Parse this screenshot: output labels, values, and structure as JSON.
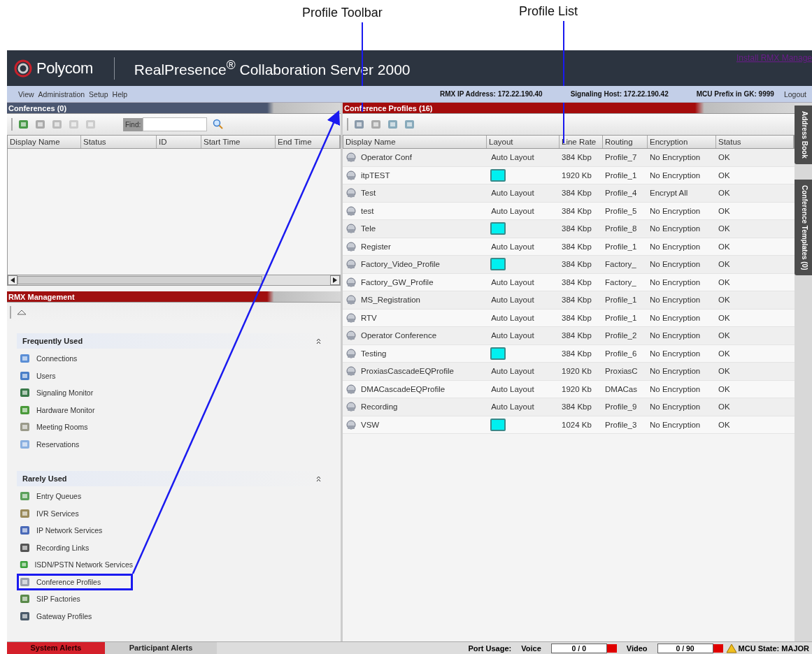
{
  "annotations": [
    {
      "label": "Profile Toolbar"
    },
    {
      "label": "Profile List"
    }
  ],
  "header": {
    "brand": "Polycom",
    "product": "RealPresence",
    "product_mark": "®",
    "product_rest": " Collaboration Server 2000",
    "link": "Install RMX Manage"
  },
  "menu": [
    "View",
    "Administration",
    "Setup",
    "Help"
  ],
  "info": [
    "RMX IP Address: 172.22.190.40",
    "Signaling Host: 172.22.190.42",
    "MCU Prefix in GK: 9999"
  ],
  "logout": "Logout",
  "conferences": {
    "title": "Conferences (0)",
    "find_label": "Find:",
    "columns": [
      "Display Name",
      "Status",
      "ID",
      "Start Time",
      "End Time"
    ]
  },
  "management": {
    "title": "RMX Management",
    "groups": [
      {
        "title": "Frequently Used",
        "items": [
          {
            "label": "Connections",
            "boxed": false
          },
          {
            "label": "Users",
            "boxed": false
          },
          {
            "label": "Signaling Monitor",
            "boxed": false
          },
          {
            "label": "Hardware Monitor",
            "boxed": false
          },
          {
            "label": "Meeting Rooms",
            "boxed": false
          },
          {
            "label": "Reservations",
            "boxed": false
          }
        ]
      },
      {
        "title": "Rarely Used",
        "items": [
          {
            "label": "Entry Queues",
            "boxed": false
          },
          {
            "label": "IVR Services",
            "boxed": false
          },
          {
            "label": "IP Network Services",
            "boxed": false
          },
          {
            "label": "Recording Links",
            "boxed": false
          },
          {
            "label": "ISDN/PSTN Network Services",
            "boxed": false
          },
          {
            "label": "Conference Profiles",
            "boxed": true
          },
          {
            "label": "SIP Factories",
            "boxed": false
          },
          {
            "label": "Gateway Profiles",
            "boxed": false
          }
        ]
      }
    ]
  },
  "profiles": {
    "title": "Conference Profiles (16)",
    "columns": [
      "Display Name",
      "Layout",
      "Line Rate",
      "Routing",
      "Encryption",
      "Status"
    ],
    "rows": [
      {
        "kind": "text",
        "name": "Operator Conf",
        "layout": "Auto Layout",
        "line_rate": "384 Kbp",
        "routing": "Profile_7",
        "encryption": "No Encryption",
        "status": "OK"
      },
      {
        "kind": "swatch",
        "name": "itpTEST",
        "line_rate": "1920 Kb",
        "routing": "Profile_1",
        "encryption": "No Encryption",
        "status": "OK"
      },
      {
        "kind": "text",
        "name": "Test",
        "layout": "Auto Layout",
        "line_rate": "384 Kbp",
        "routing": "Profile_4",
        "encryption": "Encrypt All",
        "status": "OK"
      },
      {
        "kind": "text",
        "name": "test",
        "layout": "Auto Layout",
        "line_rate": "384 Kbp",
        "routing": "Profile_5",
        "encryption": "No Encryption",
        "status": "OK"
      },
      {
        "kind": "swatch",
        "name": "Tele",
        "line_rate": "384 Kbp",
        "routing": "Profile_8",
        "encryption": "No Encryption",
        "status": "OK"
      },
      {
        "kind": "text",
        "name": "Register",
        "layout": "Auto Layout",
        "line_rate": "384 Kbp",
        "routing": "Profile_1",
        "encryption": "No Encryption",
        "status": "OK"
      },
      {
        "kind": "swatch",
        "name": "Factory_Video_Profile",
        "line_rate": "384 Kbp",
        "routing": "Factory_",
        "encryption": "No Encryption",
        "status": "OK"
      },
      {
        "kind": "text",
        "name": "Factory_GW_Profile",
        "layout": "Auto Layout",
        "line_rate": "384 Kbp",
        "routing": "Factory_",
        "encryption": "No Encryption",
        "status": "OK"
      },
      {
        "kind": "text",
        "name": "MS_Registration",
        "layout": "Auto Layout",
        "line_rate": "384 Kbp",
        "routing": "Profile_1",
        "encryption": "No Encryption",
        "status": "OK"
      },
      {
        "kind": "text",
        "name": "RTV",
        "layout": "Auto Layout",
        "line_rate": "384 Kbp",
        "routing": "Profile_1",
        "encryption": "No Encryption",
        "status": "OK"
      },
      {
        "kind": "text",
        "name": "Operator Conference",
        "layout": "Auto Layout",
        "line_rate": "384 Kbp",
        "routing": "Profile_2",
        "encryption": "No Encryption",
        "status": "OK"
      },
      {
        "kind": "swatch",
        "name": "Testing",
        "line_rate": "384 Kbp",
        "routing": "Profile_6",
        "encryption": "No Encryption",
        "status": "OK"
      },
      {
        "kind": "text",
        "name": "ProxiasCascadeEQProfile",
        "layout": "Auto Layout",
        "line_rate": "1920 Kb",
        "routing": "ProxiasC",
        "encryption": "No Encryption",
        "status": "OK"
      },
      {
        "kind": "text",
        "name": "DMACascadeEQProfile",
        "layout": "Auto Layout",
        "line_rate": "1920 Kb",
        "routing": "DMACas",
        "encryption": "No Encryption",
        "status": "OK"
      },
      {
        "kind": "text",
        "name": "Recording",
        "layout": "Auto Layout",
        "line_rate": "384 Kbp",
        "routing": "Profile_9",
        "encryption": "No Encryption",
        "status": "OK"
      },
      {
        "kind": "swatch",
        "name": "VSW",
        "line_rate": "1024 Kb",
        "routing": "Profile_3",
        "encryption": "No Encryption",
        "status": "OK"
      }
    ]
  },
  "side_tabs": [
    "Address Book",
    "Conference Templates (0)"
  ],
  "status_bar": {
    "tabs": [
      {
        "label": "System Alerts",
        "selected": true
      },
      {
        "label": "Participant Alerts",
        "selected": false
      }
    ],
    "port_usage": "Port Usage:",
    "voice_label": "Voice",
    "voice_value": "0 / 0",
    "video_label": "Video",
    "video_value": "0 / 90",
    "mcu_state": "MCU State: MAJOR"
  }
}
